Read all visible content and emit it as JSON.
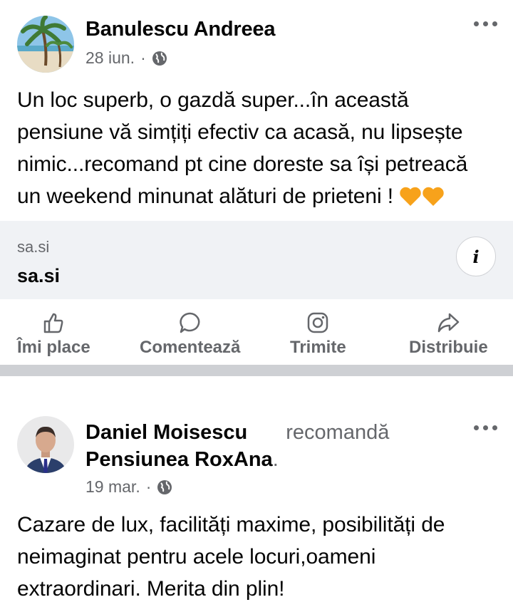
{
  "post1": {
    "author": "Banulescu Andreea",
    "date": "28 iun.",
    "separator": "·",
    "text": "Un loc superb, o gazdă super...în această pensiune vă simțiți efectiv ca acasă, nu lipsește nimic...recomand pt cine doreste sa își petreacă un weekend minunat alături de prieteni !",
    "emoji": "🧡🧡",
    "link": {
      "domain": "sa.si",
      "title": "sa.si",
      "info_icon": "i"
    },
    "actions": [
      {
        "label": "Îmi place",
        "icon": "like-icon"
      },
      {
        "label": "Comentează",
        "icon": "comment-icon"
      },
      {
        "label": "Trimite",
        "icon": "instagram-icon"
      },
      {
        "label": "Distribuie",
        "icon": "share-icon"
      }
    ]
  },
  "post2": {
    "author": "Daniel Moisescu",
    "recommend": "recomandă",
    "page": "Pensiunea RoxAna",
    "page_suffix": ".",
    "date": "19 mar.",
    "separator": "·",
    "text": "Cazare de lux, facilități maxime, posibilități de neimaginat pentru acele locuri,oameni extraordinari. Merita din plin!"
  },
  "colors": {
    "secondary": "#65676b",
    "link_bg": "#f0f2f5",
    "separator": "#ced0d4",
    "heart": "#f7a21b"
  }
}
